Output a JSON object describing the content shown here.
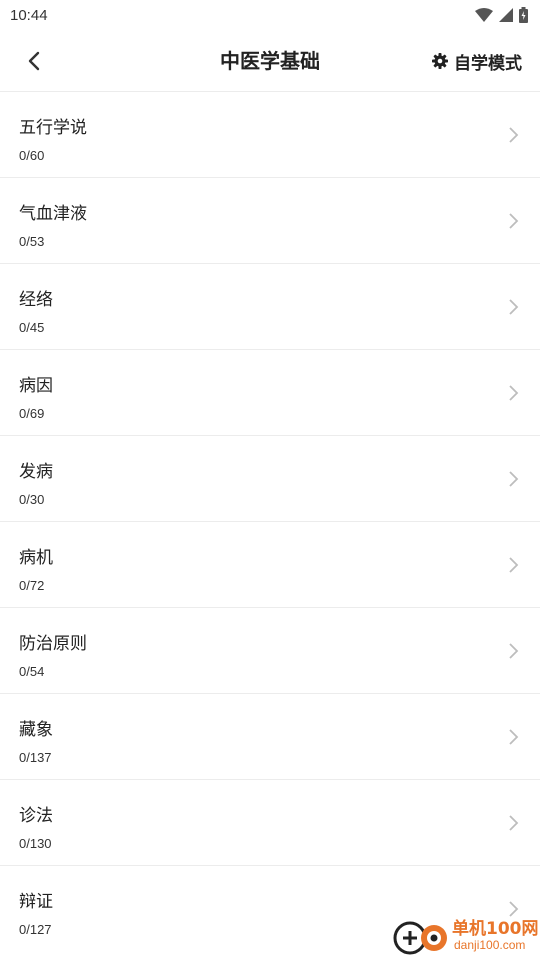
{
  "status": {
    "time": "10:44",
    "icons": [
      "wifi-icon",
      "signal-icon",
      "battery-icon"
    ]
  },
  "header": {
    "back_icon": "chevron-left-icon",
    "title": "中医学基础",
    "mode_icon": "gear-icon",
    "mode_label": "自学模式"
  },
  "list": [
    {
      "title": "五行学说",
      "progress": "0/60"
    },
    {
      "title": "气血津液",
      "progress": "0/53"
    },
    {
      "title": "经络",
      "progress": "0/45"
    },
    {
      "title": "病因",
      "progress": "0/69"
    },
    {
      "title": "发病",
      "progress": "0/30"
    },
    {
      "title": "病机",
      "progress": "0/72"
    },
    {
      "title": "防治原则",
      "progress": "0/54"
    },
    {
      "title": "藏象",
      "progress": "0/137"
    },
    {
      "title": "诊法",
      "progress": "0/130"
    },
    {
      "title": "辩证",
      "progress": "0/127"
    }
  ],
  "watermark": {
    "name": "单机100网",
    "url": "danji100.com"
  },
  "colors": {
    "divider": "#ececec",
    "chevron": "#bdbdbd",
    "watermark": "#e8752a"
  }
}
